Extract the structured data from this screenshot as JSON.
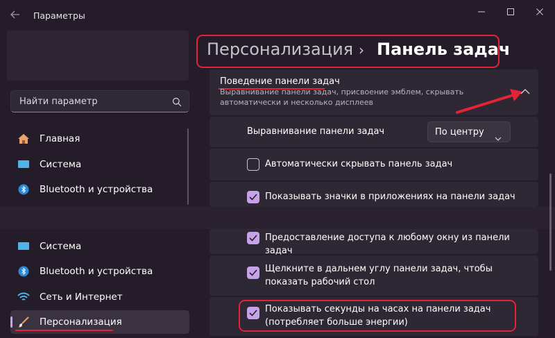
{
  "app": {
    "title": "Параметры"
  },
  "search": {
    "placeholder": "Найти параметр"
  },
  "sidebar": {
    "items_top": [
      {
        "label": "Главная"
      },
      {
        "label": "Система"
      },
      {
        "label": "Bluetooth и устройства"
      }
    ],
    "items_bottom": [
      {
        "label": "Система"
      },
      {
        "label": "Bluetooth и устройства"
      },
      {
        "label": "Сеть и Интернет"
      },
      {
        "label": "Персонализация"
      }
    ]
  },
  "breadcrumb": {
    "parent": "Персонализация",
    "separator": "›",
    "current": "Панель задач"
  },
  "section": {
    "title": "Поведение панели задач",
    "description": "Выравнивание панели задач, присвоение эмблем, скрывать автоматически и несколько дисплеев"
  },
  "alignment": {
    "label": "Выравнивание панели задач",
    "value": "По центру"
  },
  "options": [
    {
      "label": "Автоматически скрывать панель задач",
      "checked": false
    },
    {
      "label": "Показывать значки в приложениях на панели задач",
      "checked": true
    },
    {
      "label": "Предоставление доступа к любому окну из панели задач",
      "checked": true
    },
    {
      "label": "Щелкните в дальнем углу панели задач, чтобы показать рабочий стол",
      "checked": true
    },
    {
      "label": "Показывать секунды на часах на панели задач (потребляет больше энергии)",
      "checked": true
    }
  ],
  "colors": {
    "accent": "#c6a3e8",
    "highlight": "#e52236",
    "background": "#241d29",
    "card": "#2e2734"
  }
}
